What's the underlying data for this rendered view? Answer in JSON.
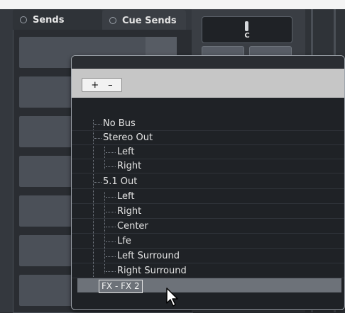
{
  "tabs": {
    "sends_label": "Sends",
    "cue_sends_label": "Cue Sends"
  },
  "pan": {
    "label": "C"
  },
  "popup": {
    "plus_label": "+",
    "minus_label": "–",
    "tree_items": [
      "No Bus",
      "Stereo Out",
      "Left",
      "Right",
      "5.1 Out",
      "Left",
      "Right",
      "Center",
      "Lfe",
      "Left Surround",
      "Right Surround"
    ],
    "selected_item": "FX - FX 2"
  },
  "colors": {
    "panel_bg": "#34383e",
    "slot_bg": "#4b5058",
    "popup_bg": "#1f2226",
    "toolbar_bg": "#c6c6c6",
    "selection_bg": "#6d7279"
  },
  "icons": {
    "radio": "radio-icon",
    "cursor": "mouse-pointer-icon"
  }
}
